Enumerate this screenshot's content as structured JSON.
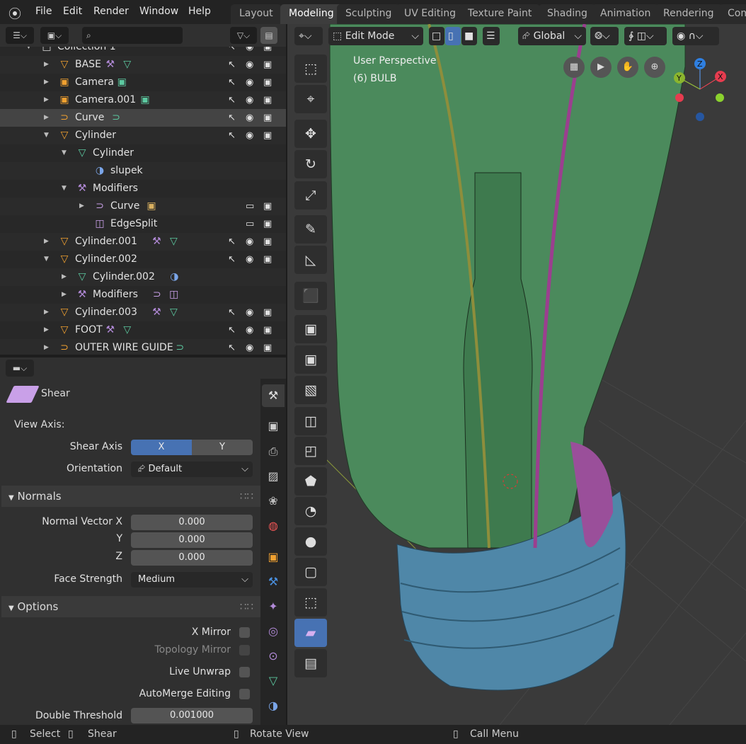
{
  "menu": [
    "File",
    "Edit",
    "Render",
    "Window",
    "Help"
  ],
  "workspaces": [
    {
      "label": "Layout"
    },
    {
      "label": "Modeling",
      "active": true
    },
    {
      "label": "Sculpting"
    },
    {
      "label": "UV Editing"
    },
    {
      "label": "Texture Paint"
    },
    {
      "label": "Shading"
    },
    {
      "label": "Animation"
    },
    {
      "label": "Rendering"
    },
    {
      "label": "Com"
    }
  ],
  "outliner": {
    "search_placeholder": "",
    "rows": [
      {
        "name": "Collection 1",
        "depth": 0,
        "icon": "collection-icon",
        "arrow": "open",
        "restrict": [
          "cursor",
          "eye",
          "camera"
        ]
      },
      {
        "name": "BASE",
        "depth": 1,
        "icon": "mesh-object-icon",
        "arrow": "closed",
        "extras": [
          "wrench",
          "mesh"
        ],
        "restrict": [
          "cursor",
          "eye",
          "camera"
        ]
      },
      {
        "name": "Camera",
        "depth": 1,
        "icon": "camera-object-icon",
        "arrow": "closed",
        "extras": [
          "camera-data"
        ],
        "restrict": [
          "cursor",
          "eye",
          "camera"
        ]
      },
      {
        "name": "Camera.001",
        "depth": 1,
        "icon": "camera-object-icon",
        "arrow": "closed",
        "extras": [
          "camera-data"
        ],
        "restrict": [
          "cursor",
          "eye",
          "camera"
        ]
      },
      {
        "name": "Curve",
        "depth": 1,
        "icon": "curve-object-icon",
        "arrow": "closed",
        "extras": [
          "curve-data"
        ],
        "restrict": [
          "cursor",
          "eye",
          "camera"
        ],
        "selected": true
      },
      {
        "name": "Cylinder",
        "depth": 1,
        "icon": "mesh-object-icon",
        "arrow": "open",
        "restrict": [
          "cursor",
          "eye",
          "camera"
        ]
      },
      {
        "name": "Cylinder",
        "depth": 2,
        "icon": "mesh-data-icon",
        "arrow": "open"
      },
      {
        "name": "slupek",
        "depth": 3,
        "icon": "material-icon"
      },
      {
        "name": "Modifiers",
        "depth": 2,
        "icon": "wrench-icon",
        "arrow": "open"
      },
      {
        "name": "Curve",
        "depth": 3,
        "icon": "curve-modifier-icon",
        "arrow": "closed",
        "extras": [
          "object-box"
        ],
        "restrict": [
          "monitor",
          "camera"
        ]
      },
      {
        "name": "EdgeSplit",
        "depth": 3,
        "icon": "edgesplit-icon",
        "restrict": [
          "monitor",
          "camera"
        ]
      },
      {
        "name": "Cylinder.001",
        "depth": 1,
        "icon": "mesh-object-icon",
        "arrow": "closed",
        "extras": [
          "wrench",
          "mesh"
        ],
        "restrict": [
          "cursor",
          "eye",
          "camera"
        ]
      },
      {
        "name": "Cylinder.002",
        "depth": 1,
        "icon": "mesh-object-icon",
        "arrow": "open",
        "restrict": [
          "cursor",
          "eye",
          "camera"
        ]
      },
      {
        "name": "Cylinder.002",
        "depth": 2,
        "icon": "mesh-data-icon",
        "arrow": "closed",
        "extras": [
          "material"
        ]
      },
      {
        "name": "Modifiers",
        "depth": 2,
        "icon": "wrench-icon",
        "arrow": "closed",
        "extras": [
          "curve",
          "edgesplit"
        ]
      },
      {
        "name": "Cylinder.003",
        "depth": 1,
        "icon": "mesh-object-icon",
        "arrow": "closed",
        "extras": [
          "wrench",
          "mesh"
        ],
        "restrict": [
          "cursor",
          "eye",
          "camera"
        ]
      },
      {
        "name": "FOOT",
        "depth": 1,
        "icon": "mesh-object-icon",
        "arrow": "closed",
        "extras": [
          "wrench",
          "mesh"
        ],
        "restrict": [
          "cursor",
          "eye",
          "camera"
        ]
      },
      {
        "name": "OUTER WIRE GUIDE",
        "depth": 1,
        "icon": "curve-object-icon",
        "arrow": "closed",
        "extras": [
          "curve-data"
        ],
        "restrict": [
          "cursor",
          "eye",
          "camera"
        ]
      }
    ]
  },
  "props": {
    "tool_name": "Shear",
    "view_axis": "View Axis:",
    "shear_axis_label": "Shear Axis",
    "shear_axis_options": [
      "X",
      "Y"
    ],
    "shear_axis_selected": "X",
    "orientation_label": "Orientation",
    "orientation_value": "Default",
    "normals_title": "Normals",
    "normal_x_label": "Normal Vector X",
    "normal_x": "0.000",
    "normal_y_label": "Y",
    "normal_y": "0.000",
    "normal_z_label": "Z",
    "normal_z": "0.000",
    "face_strength_label": "Face Strength",
    "face_strength": "Medium",
    "options_title": "Options",
    "x_mirror": "X Mirror",
    "x_mirror_checked": false,
    "topology_mirror": "Topology Mirror",
    "topology_mirror_checked": false,
    "live_unwrap": "Live Unwrap",
    "live_unwrap_checked": false,
    "automerge": "AutoMerge Editing",
    "automerge_checked": false,
    "double_threshold_label": "Double Threshold",
    "double_threshold": "0.001000"
  },
  "viewport": {
    "mode": "Edit Mode",
    "orientation": "Global",
    "view_name": "User Perspective",
    "object_info": "(6) BULB",
    "gizmo_axes": [
      "X",
      "Y",
      "Z"
    ],
    "colors": {
      "mesh": "#4a8a5a",
      "base": "#4f87a8",
      "wire_purple": "#9b3f8f",
      "accent": "#4772b3"
    }
  },
  "status": {
    "select": "Select",
    "shear": "Shear",
    "rotate": "Rotate View",
    "call_menu": "Call Menu"
  }
}
